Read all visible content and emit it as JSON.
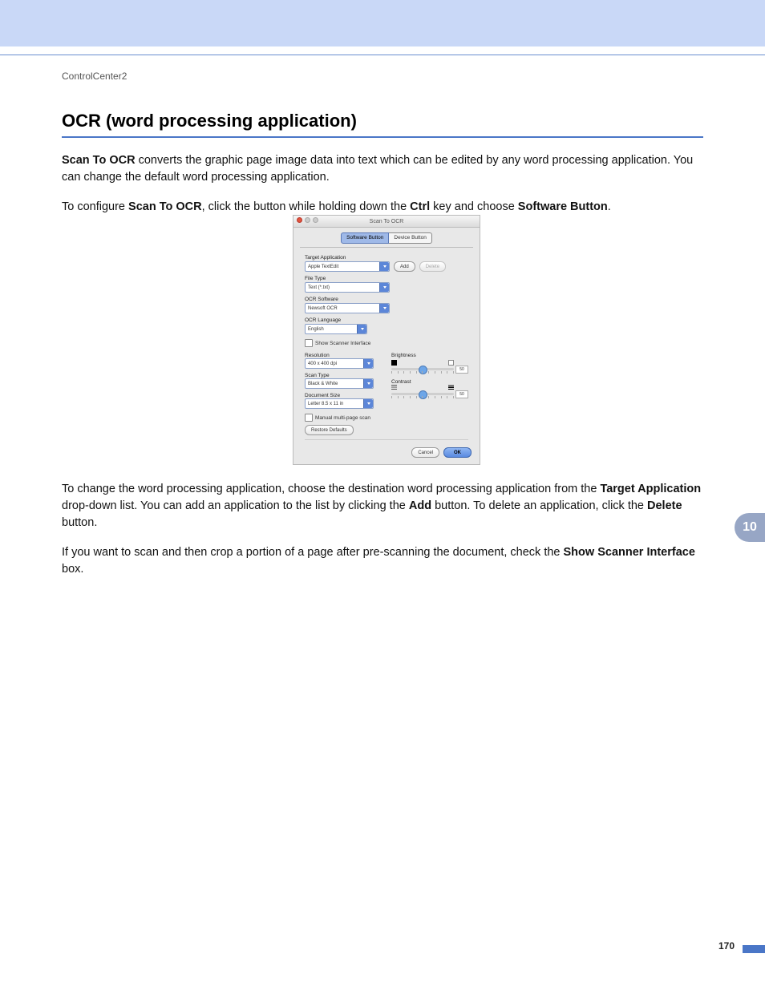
{
  "header": {
    "breadcrumb": "ControlCenter2"
  },
  "chapter": {
    "number": "10"
  },
  "footer": {
    "page": "170"
  },
  "section": {
    "title": "OCR (word processing application)",
    "p1": {
      "bold1": "Scan To OCR",
      "rest": " converts the graphic page image data into text which can be edited by any word processing application. You can change the default word processing application."
    },
    "p2": {
      "a": "To configure ",
      "b": "Scan To OCR",
      "c": ", click the button while holding down the ",
      "d": "Ctrl",
      "e": " key and choose ",
      "f": "Software Button",
      "g": "."
    },
    "p3": {
      "a": "To change the word processing application, choose the destination word processing application from the ",
      "b": "Target Application",
      "c": " drop-down list. You can add an application to the list by clicking the ",
      "d": "Add",
      "e": " button. To delete an application, click the ",
      "f": "Delete",
      "g": " button."
    },
    "p4": {
      "a": "If you want to scan and then crop a portion of a page after pre-scanning the document, check the ",
      "b": "Show Scanner Interface",
      "c": " box."
    }
  },
  "dialog": {
    "title": "Scan To OCR",
    "tabs": [
      "Software Button",
      "Device Button"
    ],
    "fields": {
      "target_app": {
        "label": "Target Application",
        "value": "Apple TextEdit"
      },
      "file_type": {
        "label": "File Type",
        "value": "Text (*.txt)"
      },
      "ocr_software": {
        "label": "OCR Software",
        "value": "Newsoft OCR"
      },
      "ocr_language": {
        "label": "OCR Language",
        "value": "English"
      },
      "resolution": {
        "label": "Resolution",
        "value": "400 x 400 dpi"
      },
      "scan_type": {
        "label": "Scan Type",
        "value": "Black & White"
      },
      "doc_size": {
        "label": "Document Size",
        "value": "Letter 8.5 x 11 in"
      }
    },
    "checkboxes": {
      "show_scanner": "Show Scanner Interface",
      "manual_multipage": "Manual multi-page scan"
    },
    "sliders": {
      "brightness": {
        "label": "Brightness",
        "value": "50"
      },
      "contrast": {
        "label": "Contrast",
        "value": "50"
      }
    },
    "buttons": {
      "add": "Add",
      "delete": "Delete",
      "restore": "Restore Defaults",
      "cancel": "Cancel",
      "ok": "OK"
    }
  }
}
